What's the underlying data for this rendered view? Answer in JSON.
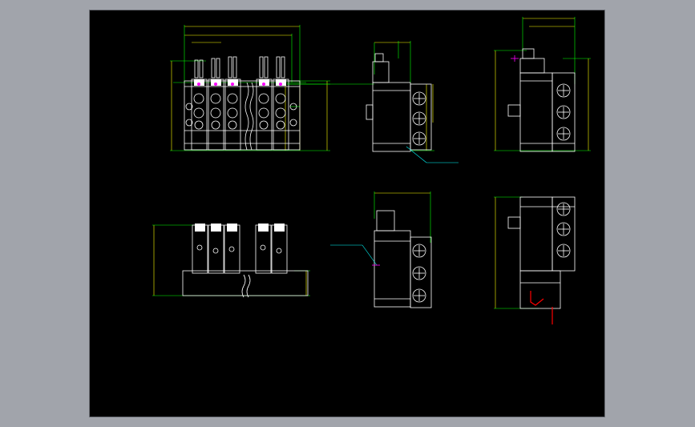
{
  "title_block": {
    "lines": [
      "",
      "",
      "",
      "",
      ""
    ]
  },
  "colors": {
    "background": "#a1a4ab",
    "canvas": "#000000",
    "outline": "#ffffff",
    "dimension": "#ffff00",
    "extension": "#00ff00",
    "callout": "#00ffff",
    "marker": "#ff00ff",
    "pointer": "#ff0000"
  },
  "views": [
    "front-view",
    "side-view-top-center",
    "side-view-top-right",
    "bottom-view",
    "side-view-bottom-center",
    "side-view-bottom-right"
  ]
}
